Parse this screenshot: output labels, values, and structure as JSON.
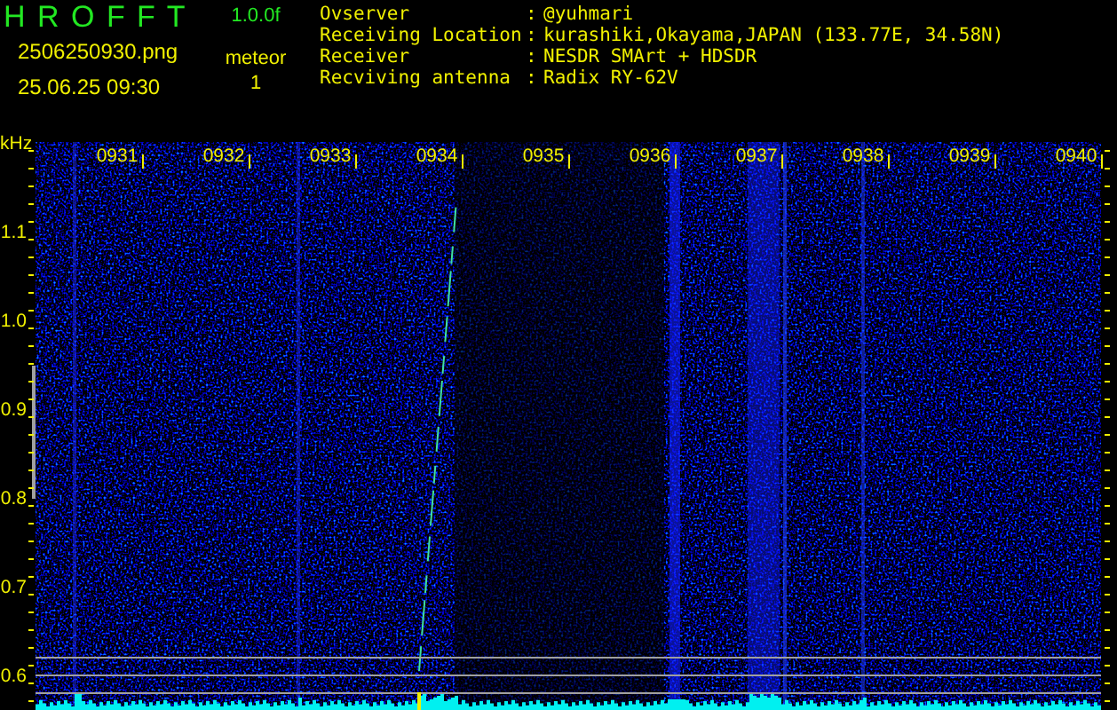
{
  "app": {
    "title": "H R O F F T",
    "version": "1.0.0f",
    "file": "2506250930.png",
    "timestamp": "25.06.25 09:30",
    "detection_label": "meteor",
    "detection_count": "1"
  },
  "info": [
    {
      "label": "Ovserver",
      "separator": ":",
      "value": "@yuhmari"
    },
    {
      "label": "Receiving Location",
      "separator": ":",
      "value": "kurashiki,Okayama,JAPAN (133.77E, 34.58N)"
    },
    {
      "label": "Receiver",
      "separator": ":",
      "value": "NESDR SMArt + HDSDR"
    },
    {
      "label": "Recviving antenna",
      "separator": ":",
      "value": "Radix RY-62V"
    }
  ],
  "spectrogram": {
    "y_unit": "kHz",
    "time_labels": [
      "0931",
      "0932",
      "0933",
      "0934",
      "0935",
      "0936",
      "0937",
      "0938",
      "0939",
      "0940"
    ],
    "freq_labels": [
      "1.1",
      "1.0",
      "0.9",
      "0.8",
      "0.7",
      "0.6"
    ]
  }
}
